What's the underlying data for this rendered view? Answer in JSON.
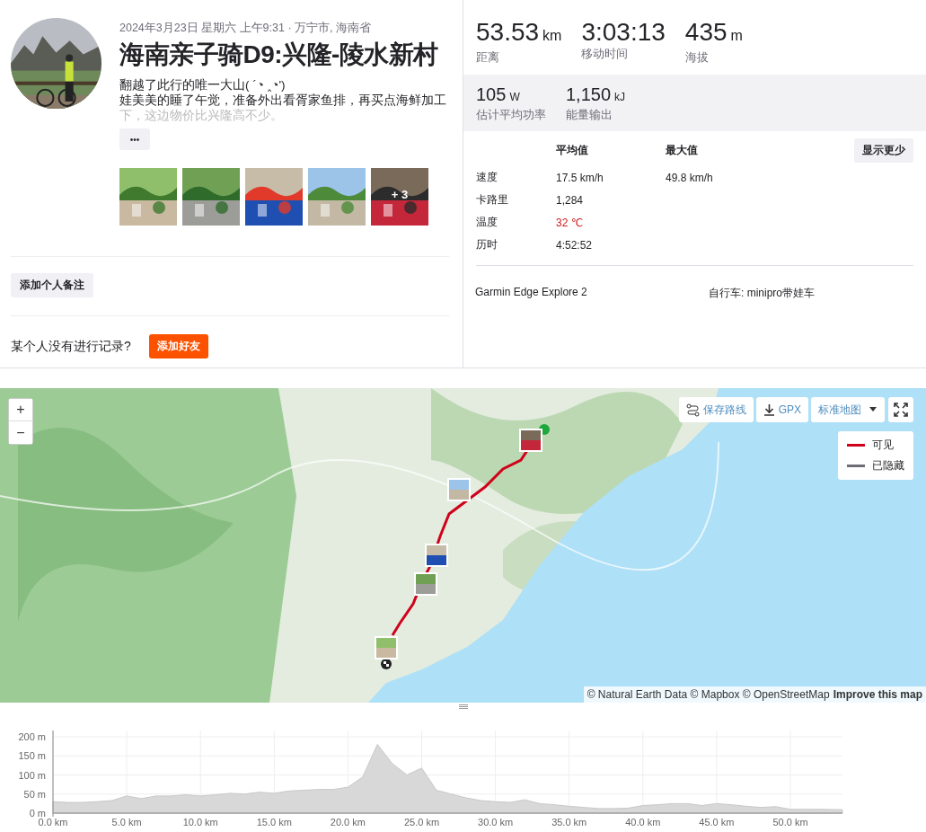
{
  "activity": {
    "meta": "2024年3月23日 星期六 上午9:31 · 万宁市, 海南省",
    "title": "海南亲子骑D9:兴隆-陵水新村",
    "description": [
      "翻越了此行的唯一大山( ´◔ ‸◔')",
      "娃美美的睡了午觉，准备外出看胥家鱼排，再买点海鲜加工",
      "下，这边物价比兴隆高不少。"
    ],
    "more_button": "•••",
    "photos": [
      {
        "kind": "picture"
      },
      {
        "kind": "picture"
      },
      {
        "kind": "picture"
      },
      {
        "kind": "picture"
      },
      {
        "kind": "picture",
        "overlay": "+ 3"
      }
    ],
    "note_button": "添加个人备注",
    "invite_text": "某个人没有进行记录?",
    "invite_button": "添加好友"
  },
  "stats": {
    "primary": [
      {
        "value": "53.53",
        "unit": "km",
        "label": "距离"
      },
      {
        "value": "3:03:13",
        "label": "移动时间"
      },
      {
        "value": "435",
        "unit": "m",
        "label": "海拔"
      }
    ],
    "secondary": [
      {
        "value": "105",
        "unit": "W",
        "label": "估计平均功率"
      },
      {
        "value": "1,150",
        "unit": "kJ",
        "label": "能量输出"
      }
    ],
    "columns": [
      "平均值",
      "最大值"
    ],
    "toggle_button": "显示更少",
    "rows": [
      {
        "label": "速度",
        "average": "17.5 km/h",
        "max": "49.8 km/h",
        "warning": false
      },
      {
        "label": "卡路里",
        "average": "1,284",
        "warning": false
      },
      {
        "label": "温度",
        "average": "32 ℃",
        "warning": true
      },
      {
        "label": "历时",
        "average": "4:52:52",
        "warning": false
      }
    ],
    "device": "Garmin Edge Explore 2",
    "bike": "自行车: minipro带娃车"
  },
  "map": {
    "zoom_in": "+",
    "zoom_out": "−",
    "save_route": "保存路线",
    "gpx": "GPX",
    "map_type": "标准地图",
    "legend": [
      {
        "label": "可见",
        "color": "#d0021b"
      },
      {
        "label": "已隐藏",
        "color": "#6d6d78"
      }
    ],
    "attribution": "© Natural Earth Data © Mapbox © OpenStreetMap",
    "improve_link": "Improve this map"
  },
  "elevation": {
    "chart_data": {
      "type": "area",
      "grid": true,
      "xlim": [
        0,
        53.53
      ],
      "ylim": [
        0,
        200
      ],
      "yticks": [
        {
          "value": 0,
          "label": "0 m"
        },
        {
          "value": 50,
          "label": "50 m"
        },
        {
          "value": 100,
          "label": "100 m"
        },
        {
          "value": 150,
          "label": "150 m"
        },
        {
          "value": 200,
          "label": "200 m"
        }
      ],
      "xticks": [
        {
          "value": 0,
          "label": "0.0 km"
        },
        {
          "value": 5,
          "label": "5.0 km"
        },
        {
          "value": 10,
          "label": "10.0 km"
        },
        {
          "value": 15,
          "label": "15.0 km"
        },
        {
          "value": 20,
          "label": "20.0 km"
        },
        {
          "value": 25,
          "label": "25.0 km"
        },
        {
          "value": 30,
          "label": "30.0 km"
        },
        {
          "value": 35,
          "label": "35.0 km"
        },
        {
          "value": 40,
          "label": "40.0 km"
        },
        {
          "value": 45,
          "label": "45.0 km"
        },
        {
          "value": 50,
          "label": "50.0 km"
        }
      ],
      "x": [
        0,
        1,
        2,
        3,
        4,
        5,
        6,
        7,
        8,
        9,
        10,
        11,
        12,
        13,
        14,
        15,
        16,
        17,
        18,
        19,
        20,
        21,
        22,
        23,
        24,
        25,
        26,
        27,
        28,
        29,
        30,
        31,
        32,
        33,
        34,
        35,
        36,
        37,
        38,
        39,
        40,
        41,
        42,
        43,
        44,
        45,
        46,
        47,
        48,
        49,
        50,
        51,
        52,
        53.53
      ],
      "series": [
        {
          "color": "#d8d8d8",
          "values": [
            30,
            28,
            28,
            30,
            33,
            45,
            38,
            45,
            45,
            48,
            45,
            48,
            52,
            50,
            55,
            52,
            58,
            60,
            62,
            62,
            68,
            95,
            180,
            130,
            100,
            118,
            60,
            50,
            40,
            33,
            30,
            28,
            35,
            25,
            22,
            18,
            15,
            12,
            12,
            13,
            20,
            22,
            25,
            25,
            20,
            25,
            22,
            18,
            15,
            17,
            10,
            10,
            10,
            9
          ]
        }
      ]
    }
  }
}
